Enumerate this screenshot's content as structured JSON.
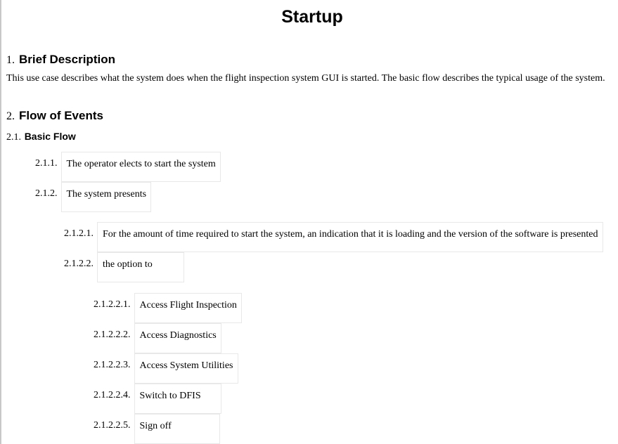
{
  "document": {
    "title": "Startup",
    "sections": [
      {
        "number": "1.",
        "heading": "Brief Description",
        "body": "This use case describes what the system does when the flight inspection system GUI is started. The basic flow describes the typical usage of the system."
      },
      {
        "number": "2.",
        "heading": "Flow of Events",
        "subsections": [
          {
            "number": "2.1.",
            "heading": "Basic Flow",
            "steps": [
              {
                "number": "2.1.1.",
                "text": "The operator elects to start the system"
              },
              {
                "number": "2.1.2.",
                "text": "The system presents"
              },
              {
                "number": "2.1.2.1.",
                "text": "For the amount of time required to start the system, an indication that it is loading and the version of the software is presented"
              },
              {
                "number": "2.1.2.2.",
                "text": "the option to"
              },
              {
                "number": "2.1.2.2.1.",
                "text": "Access Flight Inspection"
              },
              {
                "number": "2.1.2.2.2.",
                "text": "Access Diagnostics"
              },
              {
                "number": "2.1.2.2.3.",
                "text": "Access System Utilities"
              },
              {
                "number": "2.1.2.2.4.",
                "text": "Switch to DFIS"
              },
              {
                "number": "2.1.2.2.5.",
                "text": "Sign off"
              }
            ]
          }
        ]
      }
    ]
  }
}
